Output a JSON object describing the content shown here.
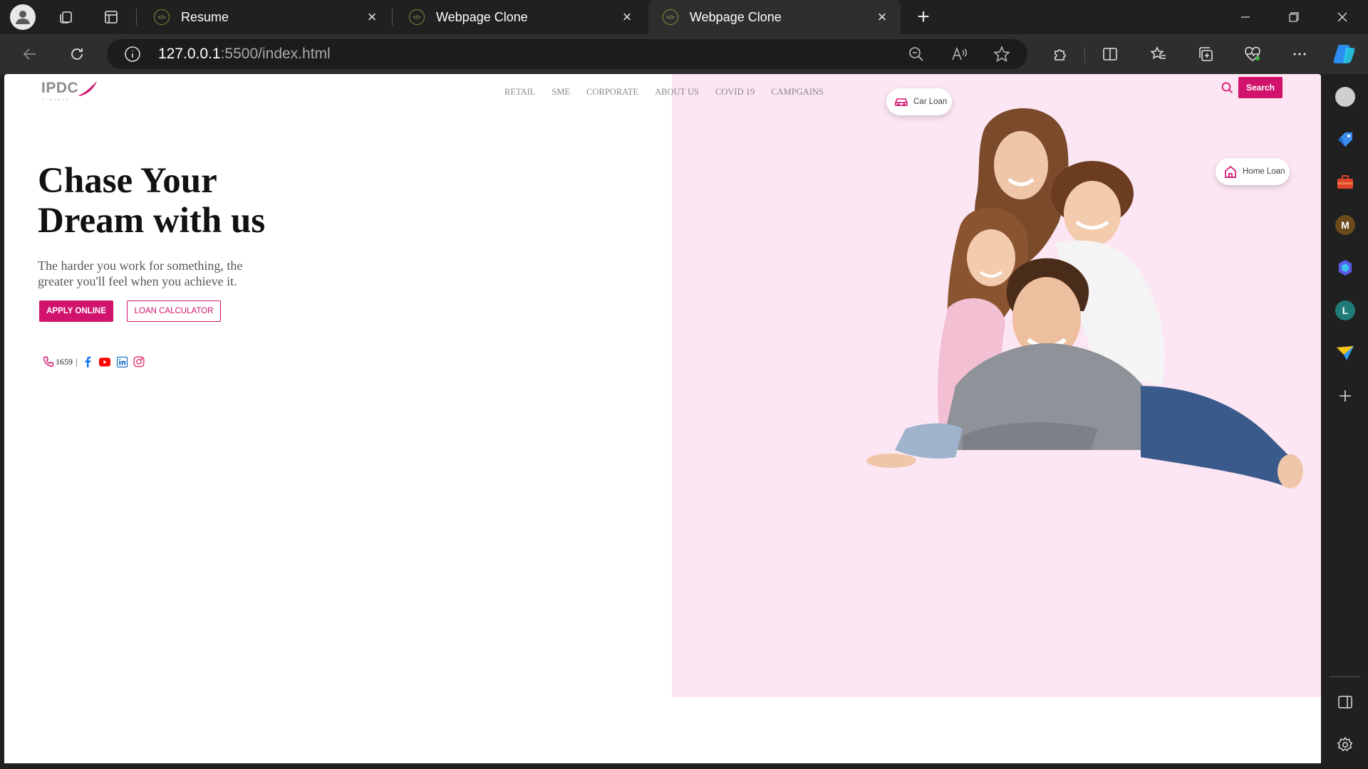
{
  "browser": {
    "tabs": [
      {
        "title": "Resume",
        "active": false
      },
      {
        "title": "Webpage Clone",
        "active": false
      },
      {
        "title": "Webpage Clone",
        "active": true
      }
    ],
    "url": {
      "host": "127.0.0.1",
      "rest": ":5500/index.html"
    },
    "side_panel_letters": [
      "M",
      "L"
    ],
    "colors": {
      "chrome": "#202020",
      "toolbar": "#2e2e2e"
    }
  },
  "page": {
    "logo": {
      "text": "IPDC",
      "sub": "FINANCE"
    },
    "nav": [
      "RETAIL",
      "SME",
      "CORPORATE",
      "ABOUT US",
      "COVID 19",
      "CAMPGAINS"
    ],
    "search_label": "Search",
    "hero": {
      "title": "Chase Your Dream with us",
      "subtitle": "The harder you work for something, the greater you'll feel when you achieve it.",
      "apply_label": "APPLY ONLINE",
      "calculator_label": "LOAN CALCULATOR"
    },
    "contact": {
      "phone": "1659",
      "separator": "|"
    },
    "socials": [
      "facebook-icon",
      "youtube-icon",
      "linkedin-icon",
      "instagram-icon"
    ],
    "pills": {
      "car_loan": "Car Loan",
      "home_loan": "Home Loan"
    },
    "colors": {
      "accent": "#d1136d",
      "pink_panel": "#fde6f4"
    }
  }
}
